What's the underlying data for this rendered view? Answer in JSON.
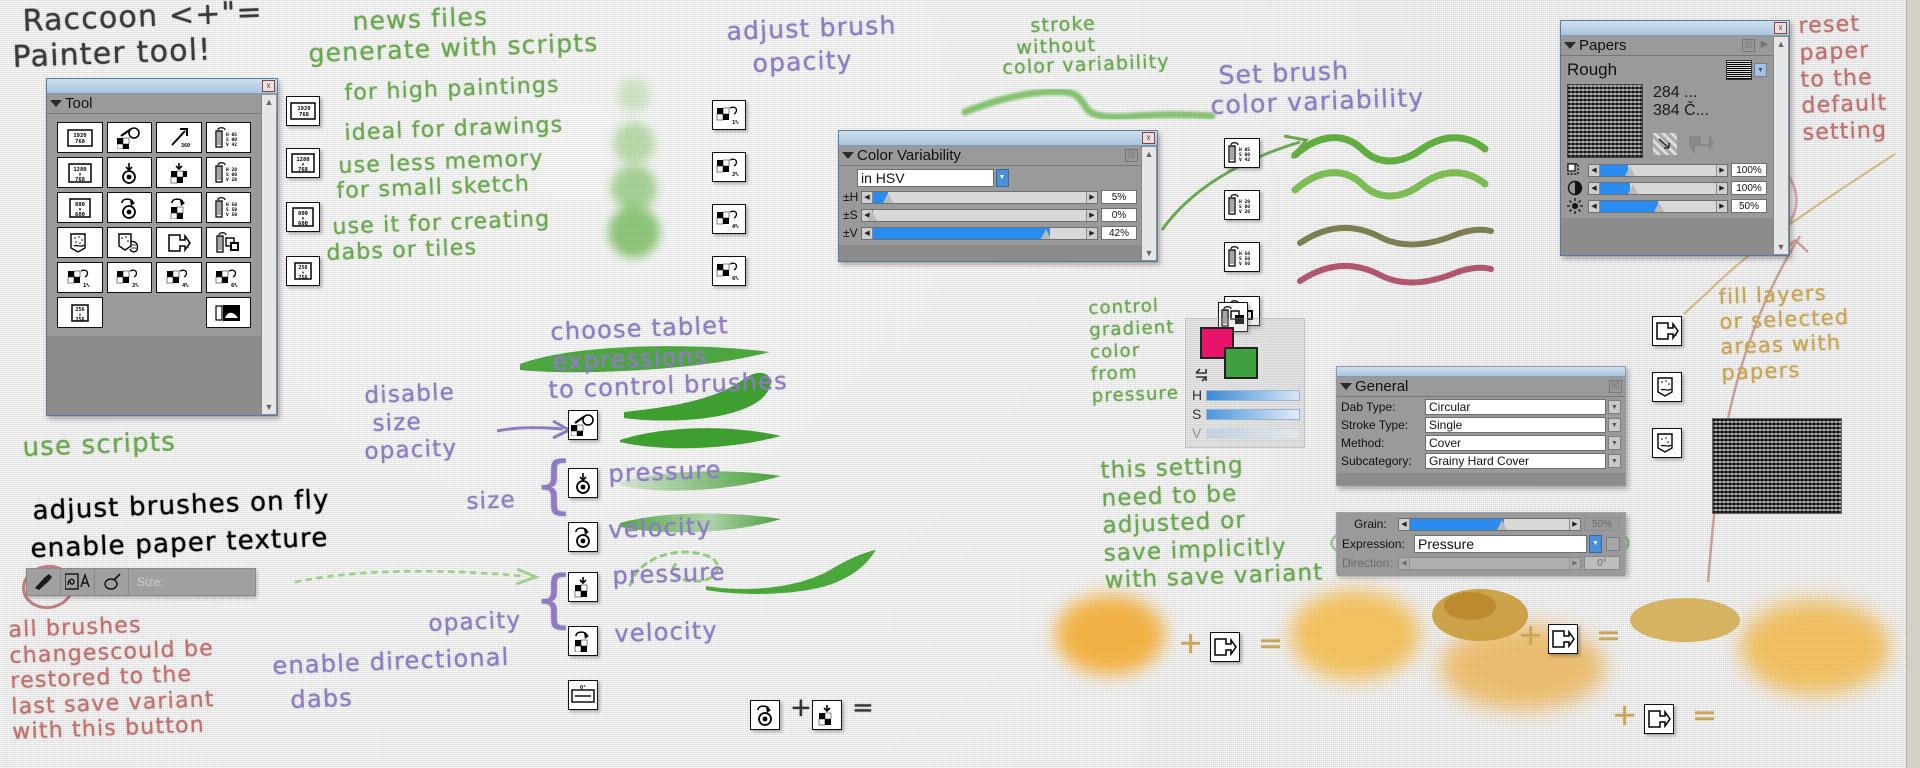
{
  "title_note": {
    "line1": "Raccoon <+\"=",
    "line2": "Painter tool!"
  },
  "annotations": {
    "news_files": "news files",
    "generate_scripts": "generate with scripts",
    "high_paintings": "for high paintings",
    "ideal_drawings": "ideal for drawings",
    "less_memory": "use less memory",
    "small_sketch": "for small sketch",
    "creating": "use it for creating",
    "dabs_tiles": "dabs or tiles",
    "adjust_brush": "adjust brush",
    "opacity": "opacity",
    "stroke_without1": "stroke",
    "stroke_without2": "without",
    "stroke_without3": "color variability",
    "set_brush1": "Set brush",
    "set_brush2": "color variability",
    "reset_paper": "reset\npaper\nto the\ndefault\nsetting",
    "fill_layers": "fill layers\nor selected\nareas with\npapers",
    "choose_tablet1": "choose tablet",
    "choose_tablet2": "expressions",
    "choose_tablet3": "to control brushes",
    "disable": "disable",
    "size_w": "size",
    "opacity_w": "opacity",
    "size_brace": "size",
    "opacity_brace": "opacity",
    "pressure1": "pressure",
    "velocity1": "velocity",
    "pressure2": "pressure",
    "velocity2": "velocity",
    "use_scripts": "use scripts",
    "adjust_fly_a": "adjust ",
    "adjust_fly_b": "brushes",
    "adjust_fly_c": " on fly",
    "enable_a": "enable ",
    "enable_b": "paper",
    "enable_c": " texture",
    "all_brushes": "all brushes\nchangescould be\nrestored to the\nlast save variant\nwith this button",
    "enable_dir1": "enable directional",
    "enable_dir2": "dabs",
    "control_gradient": "control\ngradient\ncolor\nfrom\npressure",
    "this_setting": "this setting\nneed to be\nadjusted or\nsave implicitly\nwith save variant"
  },
  "tool_panel": {
    "title": "Tool",
    "buttons": [
      "× 1920\n768",
      "brush-disc",
      "rotate-360°",
      "H 05\nS 00\nV 42",
      "1280\n×\n768",
      "dab-target",
      "dab-checker",
      "H 20\nS 00\nV 20",
      "800\n×\n600",
      "rot-target",
      "rot-checker",
      "H 50\nS 50\nV 50",
      "grain-paper",
      "grain-hand",
      "fill-arrow",
      "layer-stack",
      "1%",
      "2%",
      "4%",
      "6%",
      "256\n×\n256",
      "",
      "",
      "texture-preview"
    ]
  },
  "size_chips": [
    "× 1920\n768",
    "1280\n×\n768",
    "800\n×\n600",
    "256\n×\n256"
  ],
  "opacity_chips": [
    "1%",
    "2%",
    "4%",
    "6%"
  ],
  "hsv_chips": [
    "H 05\nS 00\nV 42",
    "H 20\nS 00\nV 20",
    "H 50\nS 50\nV 50",
    "layer-stack"
  ],
  "color_variability": {
    "title": "Color Variability",
    "mode": "in HSV",
    "rows": [
      {
        "label": "±H",
        "value": "5%",
        "pct": 11
      },
      {
        "label": "±S",
        "value": "0%",
        "pct": 2
      },
      {
        "label": "±V",
        "value": "42%",
        "pct": 80
      }
    ]
  },
  "papers": {
    "title": "Papers",
    "name": "Rough",
    "info_line1": "284 ...",
    "info_line2": "384 Č...",
    "rows": [
      {
        "icon": "scale-icon",
        "value": "100%",
        "pct": 28
      },
      {
        "icon": "contrast-icon",
        "value": "100%",
        "pct": 30
      },
      {
        "icon": "brightness-icon",
        "value": "50%",
        "pct": 50
      }
    ]
  },
  "general": {
    "title": "General",
    "fields": [
      {
        "label": "Dab Type:",
        "value": "Circular"
      },
      {
        "label": "Stroke Type:",
        "value": "Single"
      },
      {
        "label": "Method:",
        "value": "Cover"
      },
      {
        "label": "Subcategory:",
        "value": "Grainy Hard Cover"
      }
    ],
    "grain": {
      "label": "Grain:",
      "value": "50%",
      "pct": 58
    },
    "expression": {
      "label": "Expression:",
      "value": "Pressure"
    },
    "direction": {
      "label": "Direction:",
      "value": "0°"
    }
  },
  "color_picker": {
    "h": "H",
    "s": "S",
    "v": "V",
    "front": "#e8136b",
    "back": "#3fa03f"
  },
  "brush_toolbar": {
    "size_label": "Size:",
    "brush_icon": "brush-icon",
    "variant_icon": "variant-icon",
    "clone_icon": "clone-icon"
  },
  "plus_equals": {
    "plus": "+",
    "equals": "="
  }
}
